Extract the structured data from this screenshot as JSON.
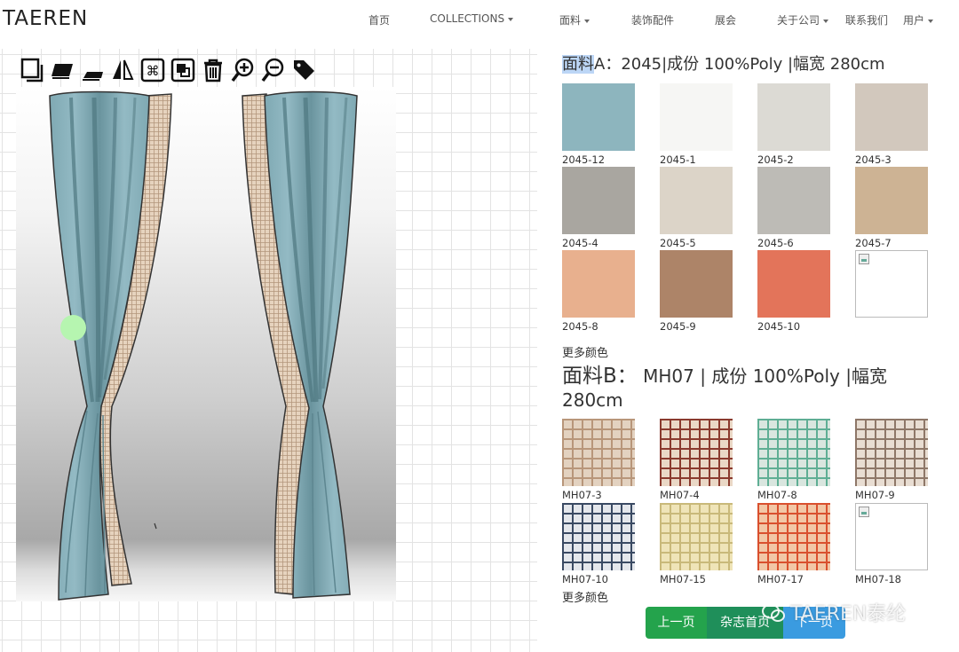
{
  "brand": "TAEREN",
  "nav": {
    "home": "首页",
    "collections": "COLLECTIONS",
    "fabrics": "面料",
    "accessories": "装饰配件",
    "exhibition": "展会",
    "about": "关于公司",
    "contact": "联系我们",
    "user": "用户"
  },
  "toolbar_icons": [
    "copy-icon",
    "layer-icon",
    "underlay-icon",
    "flip-icon",
    "command-icon",
    "group-icon",
    "trash-icon",
    "zoom-in-icon",
    "zoom-out-icon",
    "tag-icon"
  ],
  "fabric_a": {
    "label": "面料",
    "suffix": "A：2045|成份 100%Poly |幅宽 280cm",
    "swatches": [
      {
        "code": "2045-12",
        "color": "#8db5be"
      },
      {
        "code": "2045-1",
        "color": "#f6f6f4"
      },
      {
        "code": "2045-2",
        "color": "#dcdad4"
      },
      {
        "code": "2045-3",
        "color": "#d2c8bd"
      },
      {
        "code": "2045-4",
        "color": "#a9a6a0"
      },
      {
        "code": "2045-5",
        "color": "#dcd4c8"
      },
      {
        "code": "2045-6",
        "color": "#bdbbb6"
      },
      {
        "code": "2045-7",
        "color": "#cdb394"
      },
      {
        "code": "2045-8",
        "color": "#e8b08e"
      },
      {
        "code": "2045-9",
        "color": "#ad8468"
      },
      {
        "code": "2045-10",
        "color": "#e3745a"
      },
      {
        "code": "",
        "color": ""
      }
    ],
    "more": "更多颜色"
  },
  "fabric_b": {
    "label": "面料B：",
    "suffix": "MH07 | 成份 100%Poly |幅宽",
    "suffix2": "280cm",
    "swatches": [
      {
        "code": "MH07-3",
        "color": "#e3d2c0",
        "line": "#b8967a"
      },
      {
        "code": "MH07-4",
        "color": "#ead8c6",
        "line": "#8a3a2e"
      },
      {
        "code": "MH07-8",
        "color": "#d9e6df",
        "line": "#5fae94"
      },
      {
        "code": "MH07-9",
        "color": "#e8ddd2",
        "line": "#8e7768"
      },
      {
        "code": "MH07-10",
        "color": "#e4e7ec",
        "line": "#3a4a63"
      },
      {
        "code": "MH07-15",
        "color": "#efe4b8",
        "line": "#c9b97a"
      },
      {
        "code": "MH07-17",
        "color": "#f2c7a6",
        "line": "#d9502e"
      },
      {
        "code": "MH07-18",
        "color": "",
        "line": ""
      }
    ],
    "more": "更多颜色"
  },
  "pager": {
    "prev": "上一页",
    "home": "杂志首页",
    "next": "下一页"
  },
  "watermark": "TAEREN泰纶"
}
